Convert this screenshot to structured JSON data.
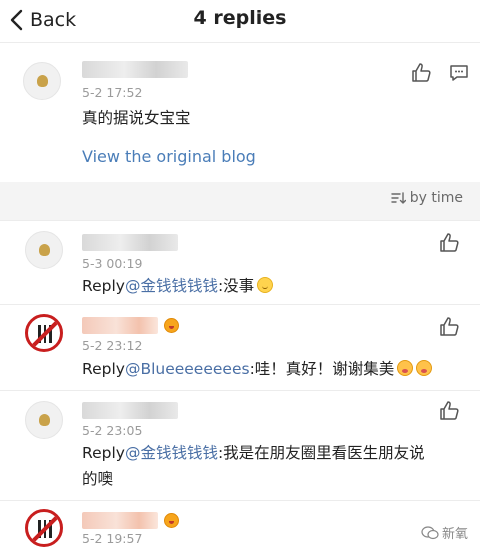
{
  "nav": {
    "back_label": "Back",
    "title": "4 replies"
  },
  "original": {
    "time": "5-2 17:52",
    "text": "真的据说女宝宝",
    "link_label": "View the original blog"
  },
  "sort": {
    "label": "by time"
  },
  "comments": [
    {
      "time": "5-3 00:19",
      "reply": "Reply",
      "mention": "@金钱钱钱钱",
      "text": ":没事"
    },
    {
      "time": "5-2 23:12",
      "reply": "Reply",
      "mention": "@Blueeeeeeees",
      "text": ":哇！真好！谢谢集美"
    },
    {
      "time": "5-2 23:05",
      "reply": "Reply",
      "mention": "@金钱钱钱钱",
      "text": ":我是在朋友圈里看医生朋友说",
      "text_line2": "的噢"
    },
    {
      "time": "5-2 19:57"
    }
  ],
  "watermark": {
    "text": "新氧"
  },
  "icons": [
    "chevron-left-icon",
    "thumbs-up-icon",
    "comment-icon",
    "sort-icon",
    "emoji-icon"
  ]
}
